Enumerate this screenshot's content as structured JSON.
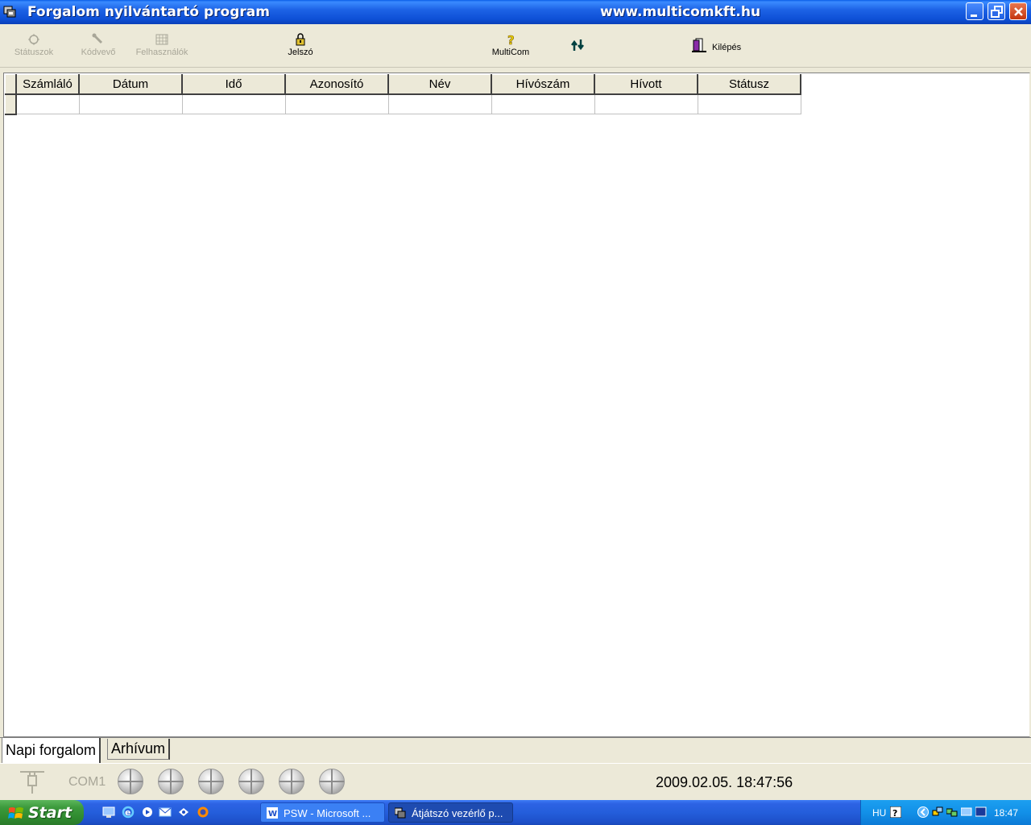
{
  "window": {
    "title": "Forgalom nyilvántartó program",
    "url": "www.multicomkft.hu"
  },
  "toolbar": {
    "statuszok": "Státuszok",
    "kodvevo": "Kódvevő",
    "felhasznalok": "Felhasználók",
    "jelszo": "Jelszó",
    "multicom": "MultiCom",
    "kilepes": "Kilépés"
  },
  "grid": {
    "columns": [
      "Számláló",
      "Dátum",
      "Idő",
      "Azonosító",
      "Név",
      "Hívószám",
      "Hívott",
      "Státusz"
    ]
  },
  "tabs": {
    "napi": "Napi forgalom",
    "arhivum": "Arhívum"
  },
  "status": {
    "port": "COM1",
    "datetime": "2009.02.05. 18:47:56"
  },
  "taskbar": {
    "start": "Start",
    "task1": "PSW - Microsoft ...",
    "task2": "Átjátszó vezérlő p...",
    "language": "HU",
    "clock": "18:47"
  }
}
